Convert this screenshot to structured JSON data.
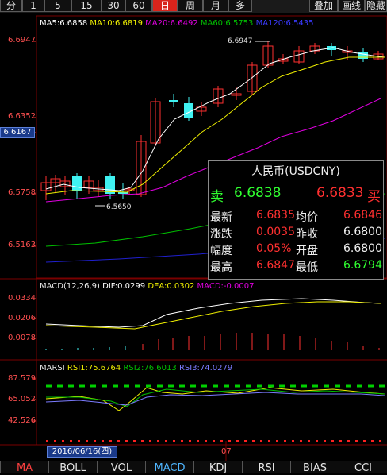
{
  "toolbar": {
    "periods": [
      "分",
      "1",
      "5",
      "15",
      "30",
      "60",
      "日",
      "周",
      "月",
      "多"
    ],
    "active_period": "日",
    "right_buttons": [
      "叠加",
      "画线",
      "隐藏"
    ]
  },
  "colors": {
    "up": "#ff3030",
    "down": "#3ff2f2",
    "ma5": "#ffffff",
    "ma10": "#f0f000",
    "ma20": "#e000e0",
    "ma60": "#00c000",
    "ma120": "#2020d0",
    "axis_red": "#ff5050"
  },
  "kline": {
    "legend": [
      {
        "label": "MA5:6.6858",
        "color": "#ffffff"
      },
      {
        "label": "MA10:6.6819",
        "color": "#f0f000"
      },
      {
        "label": "MA20:6.6492",
        "color": "#e000e0"
      },
      {
        "label": "MA60:6.5753",
        "color": "#00c000"
      },
      {
        "label": "MA120:6.5435",
        "color": "#3a3aff"
      }
    ],
    "y_ticks": [
      "6.6947",
      "6.6352",
      "6.5758",
      "6.5163"
    ],
    "current_price_tag": "6.6167",
    "high_marker": "6.6947",
    "low_marker": "6.5650"
  },
  "info_panel": {
    "title": "人民币(USDCNY)",
    "sell_label": "卖",
    "sell_value": "6.6838",
    "buy_value": "6.6833",
    "buy_label": "买",
    "rows": [
      {
        "l1": "最新",
        "v1": "6.6835",
        "l2": "均价",
        "v2": "6.6846",
        "c1": "#ff3030",
        "c2": "#ff3030"
      },
      {
        "l1": "涨跌",
        "v1": "0.0035",
        "l2": "昨收",
        "v2": "6.6800",
        "c1": "#ff3030",
        "c2": "#f0f0f0"
      },
      {
        "l1": "幅度",
        "v1": "0.05%",
        "l2": "开盘",
        "v2": "6.6800",
        "c1": "#ff3030",
        "c2": "#f0f0f0"
      },
      {
        "l1": "最高",
        "v1": "6.6847",
        "l2": "最低",
        "v2": "6.6794",
        "c1": "#ff3030",
        "c2": "#30ff30"
      }
    ]
  },
  "macd": {
    "legend": [
      {
        "label": "MACD(12,26,9)",
        "color": "#e6e6e6"
      },
      {
        "label": "DIF:0.0299",
        "color": "#ffffff"
      },
      {
        "label": "DEA:0.0302",
        "color": "#f0f000"
      },
      {
        "label": "MACD:-0.0007",
        "color": "#e000e0"
      }
    ],
    "y_ticks": [
      "0.0334",
      "0.0206",
      "0.0078"
    ]
  },
  "rsi": {
    "legend": [
      {
        "label": "MARSI",
        "color": "#e6e6e6"
      },
      {
        "label": "RSI1:75.6764",
        "color": "#f0f000"
      },
      {
        "label": "RSI2:76.6013",
        "color": "#00c000"
      },
      {
        "label": "RSI3:74.0279",
        "color": "#7b7bff"
      }
    ],
    "y_ticks": [
      "87.579",
      "65.052",
      "42.526"
    ]
  },
  "date_bar": {
    "cursor_date": "2016/06/16(四)",
    "month_label": "07"
  },
  "tabs": {
    "items": [
      "MA",
      "BOLL",
      "VOL",
      "MACD",
      "KDJ",
      "RSI",
      "BIAS",
      "CCI"
    ],
    "active_main": "MA",
    "active_sub": "MACD"
  }
}
